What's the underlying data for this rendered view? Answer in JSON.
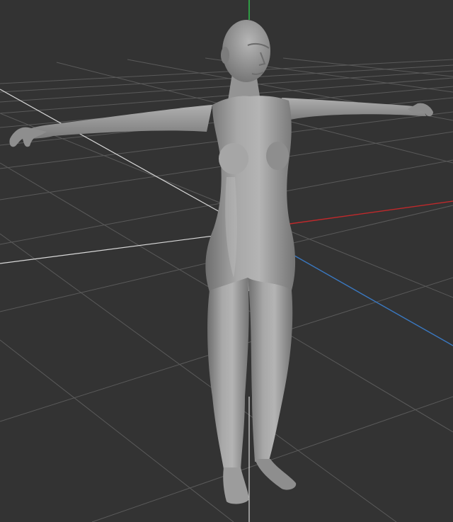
{
  "viewport": {
    "view": "perspective",
    "shading": "solid",
    "grid_visible": true,
    "background_color": "#333333",
    "grid_color": "#5a5a5a",
    "grid_major_color": "#d8d8d8",
    "model_color": "#9a9a9a"
  },
  "axes": {
    "x": {
      "name": "x-axis",
      "color": "#c0292b"
    },
    "y": {
      "name": "y-axis",
      "color": "#2fb84a"
    },
    "z": {
      "name": "z-axis",
      "color": "#3a78c0"
    }
  },
  "model": {
    "kind": "female base mesh",
    "pose": "t-pose"
  }
}
